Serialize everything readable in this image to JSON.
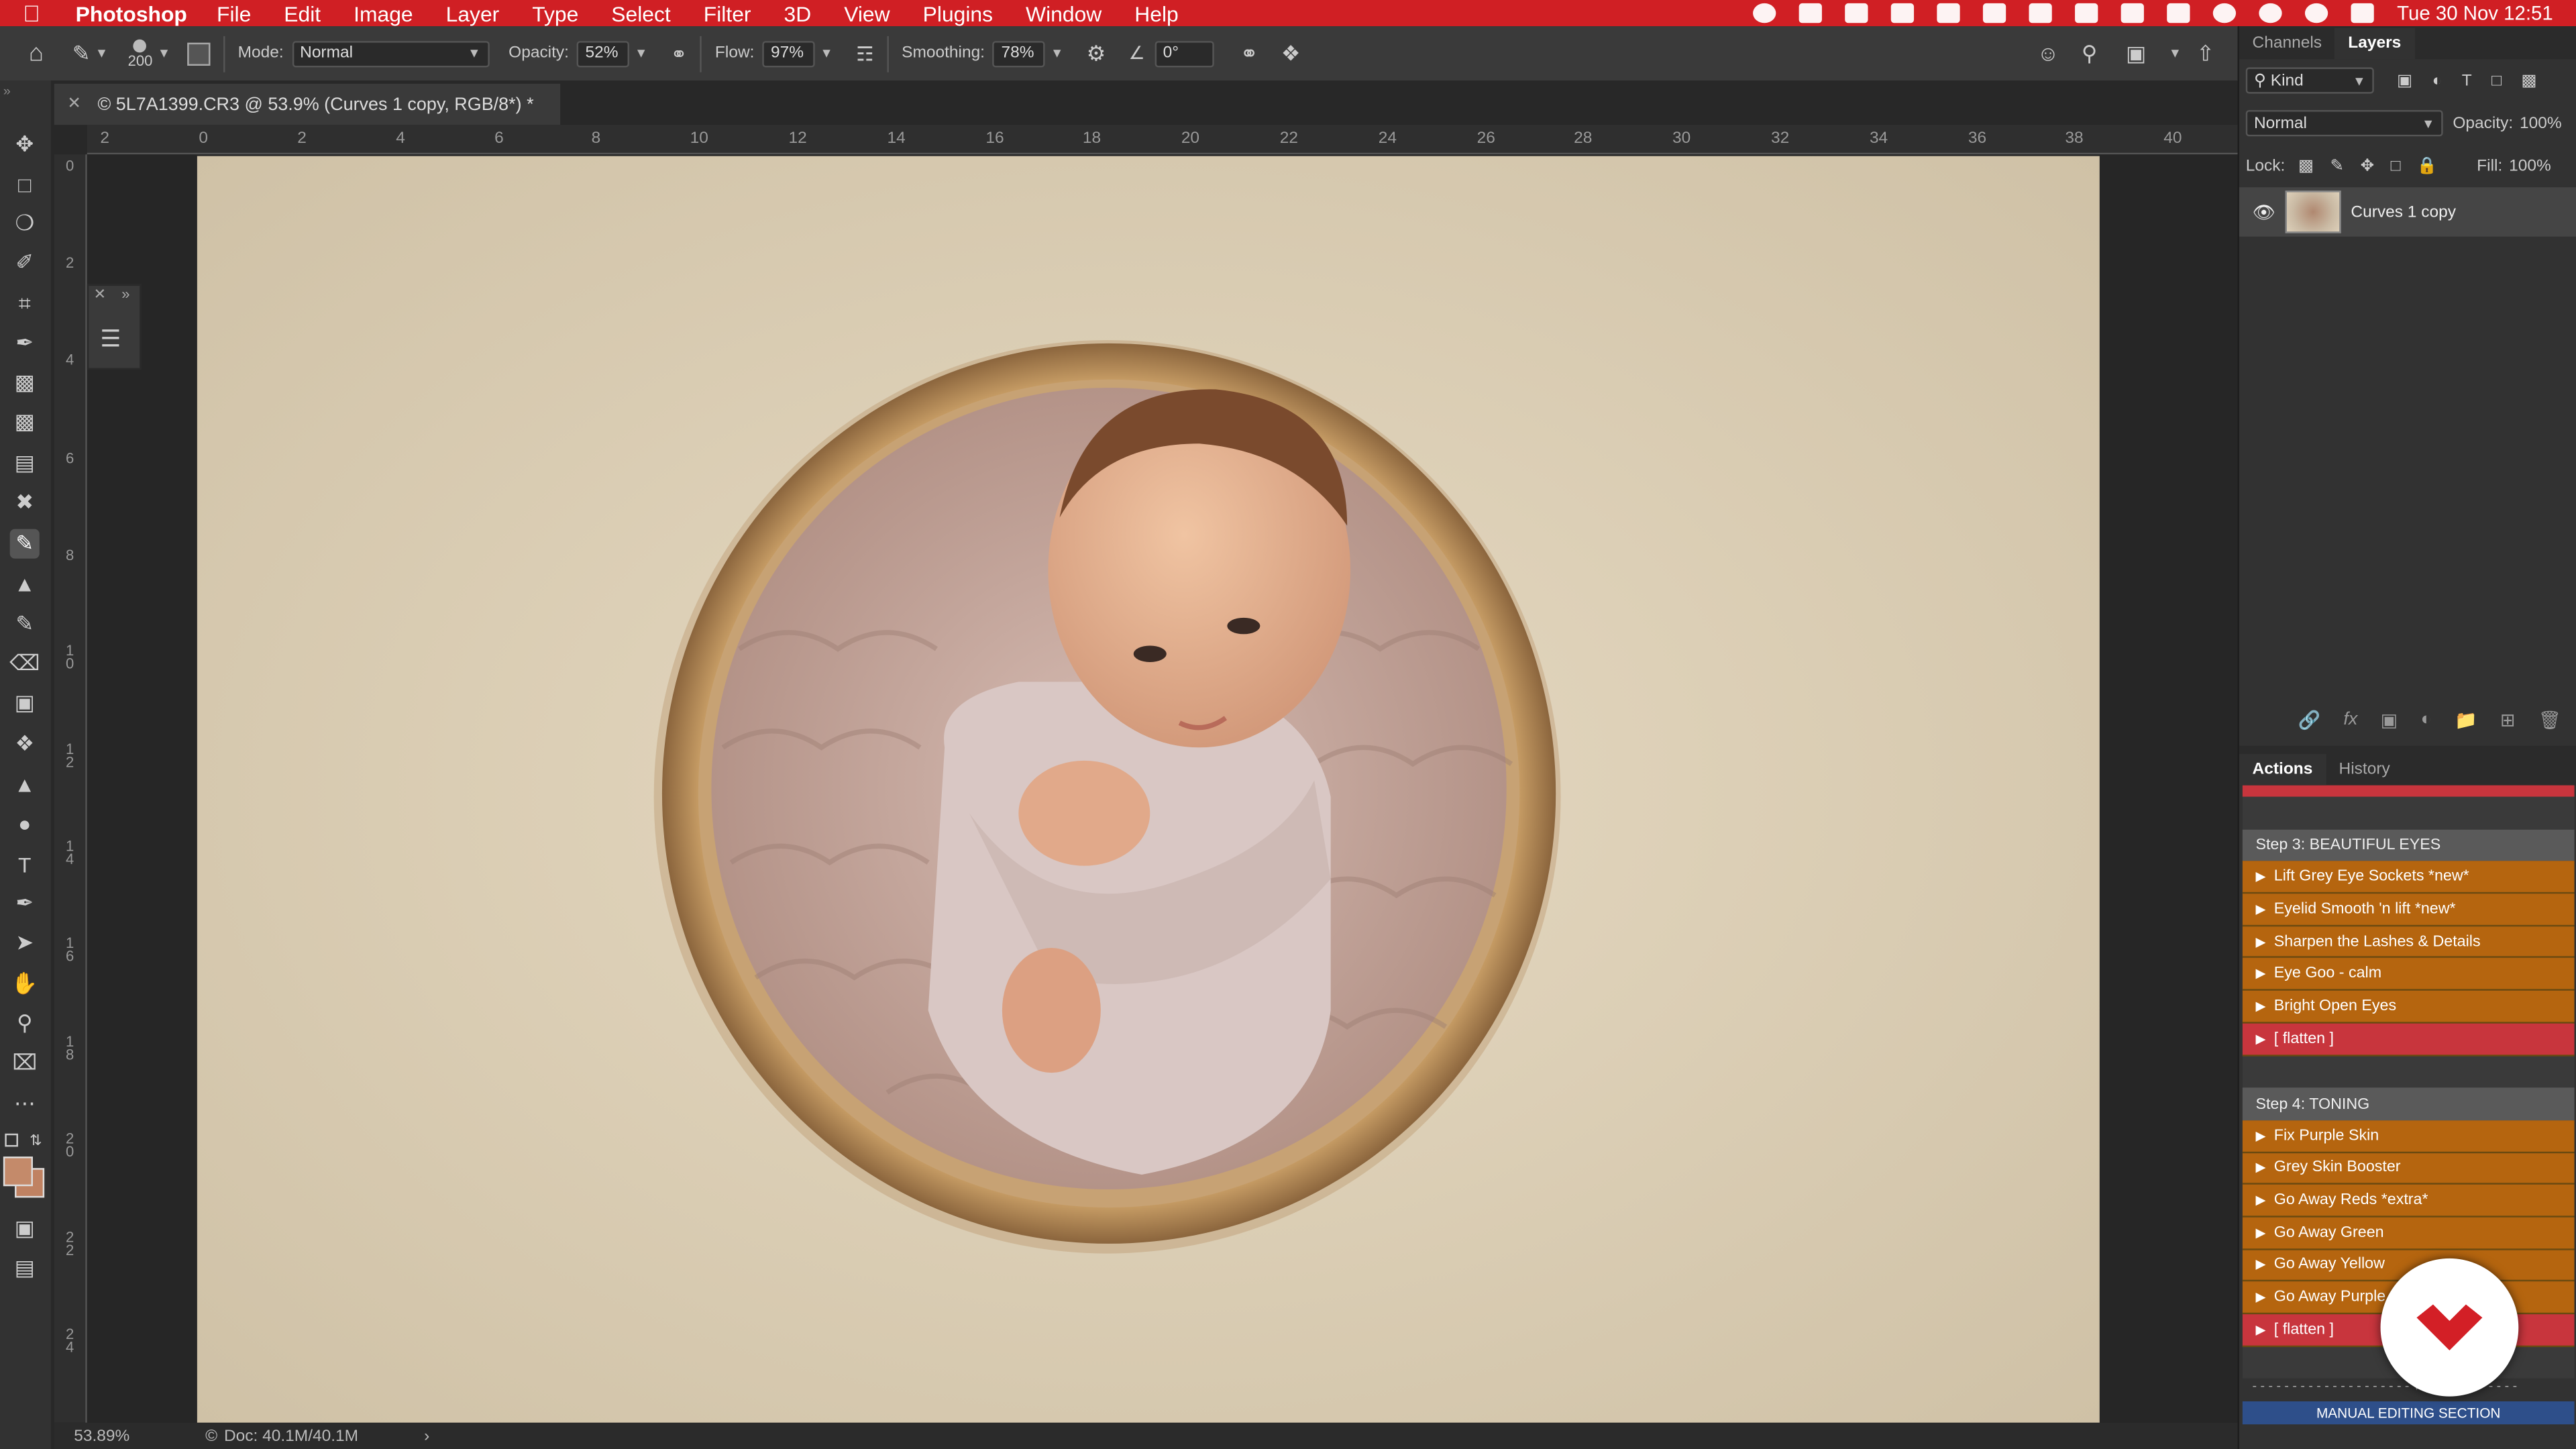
{
  "menubar": {
    "app_name": "Photoshop",
    "items": [
      "File",
      "Edit",
      "Image",
      "Layer",
      "Type",
      "Select",
      "Filter",
      "3D",
      "View",
      "Plugins",
      "Window",
      "Help"
    ],
    "clock": "Tue 30 Nov 12:51",
    "accent_color": "#d01f24"
  },
  "options": {
    "brush_size": "200",
    "mode_label": "Mode:",
    "mode_value": "Normal",
    "opacity_label": "Opacity:",
    "opacity_value": "52%",
    "flow_label": "Flow:",
    "flow_value": "97%",
    "smoothing_label": "Smoothing:",
    "smoothing_value": "78%",
    "angle_value": "0°"
  },
  "document": {
    "tab_title": "© 5L7A1399.CR3 @ 53.9% (Curves 1 copy, RGB/8*) *",
    "zoom": "53.89%",
    "doc_size": "Doc: 40.1M/40.1M"
  },
  "rulers": {
    "top": [
      "2",
      "0",
      "2",
      "4",
      "6",
      "8",
      "10",
      "12",
      "14",
      "16",
      "18",
      "20",
      "22",
      "24",
      "26",
      "28",
      "30",
      "32",
      "34",
      "36",
      "38",
      "40"
    ],
    "left": [
      "0",
      "2",
      "4",
      "6",
      "8",
      "1\n0",
      "1\n2",
      "1\n4",
      "1\n6",
      "1\n8",
      "2\n0",
      "2\n2",
      "2\n4"
    ]
  },
  "layers_panel": {
    "tabs": [
      "Channels",
      "Layers"
    ],
    "active_tab": "Layers",
    "filter_label": "Kind",
    "blend_mode": "Normal",
    "opacity_label": "Opacity:",
    "opacity_value": "100%",
    "lock_label": "Lock:",
    "fill_label": "Fill:",
    "fill_value": "100%",
    "layers": [
      {
        "name": "Curves 1 copy"
      }
    ]
  },
  "actions_panel": {
    "tabs": [
      "Actions",
      "History"
    ],
    "active_tab": "Actions",
    "groups": [
      {
        "header": "Step 3: BEAUTIFUL EYES",
        "items": [
          {
            "label": "Lift Grey Eye Sockets  *new*",
            "color": "orange"
          },
          {
            "label": "Eyelid Smooth 'n lift  *new*",
            "color": "orange"
          },
          {
            "label": "Sharpen the Lashes & Details",
            "color": "orange"
          },
          {
            "label": "Eye Goo - calm",
            "color": "orange"
          },
          {
            "label": "Bright Open Eyes",
            "color": "orange"
          },
          {
            "label": "[ flatten ]",
            "color": "red"
          }
        ]
      },
      {
        "header": "Step 4: TONING",
        "items": [
          {
            "label": "Fix Purple Skin",
            "color": "orange"
          },
          {
            "label": "Grey Skin Booster",
            "color": "orange"
          },
          {
            "label": "Go Away Reds *extra*",
            "color": "orange"
          },
          {
            "label": "Go Away Green",
            "color": "orange"
          },
          {
            "label": "Go Away Yellow",
            "color": "orange"
          },
          {
            "label": "Go Away Purple",
            "color": "orange"
          },
          {
            "label": "[ flatten ]",
            "color": "red"
          }
        ]
      }
    ],
    "footer_divider": "- - - - - - - - - - - - - - - - - - - -  ♥  - - - - - - - - - - - -",
    "footer_label": "MANUAL EDITING SECTION"
  }
}
